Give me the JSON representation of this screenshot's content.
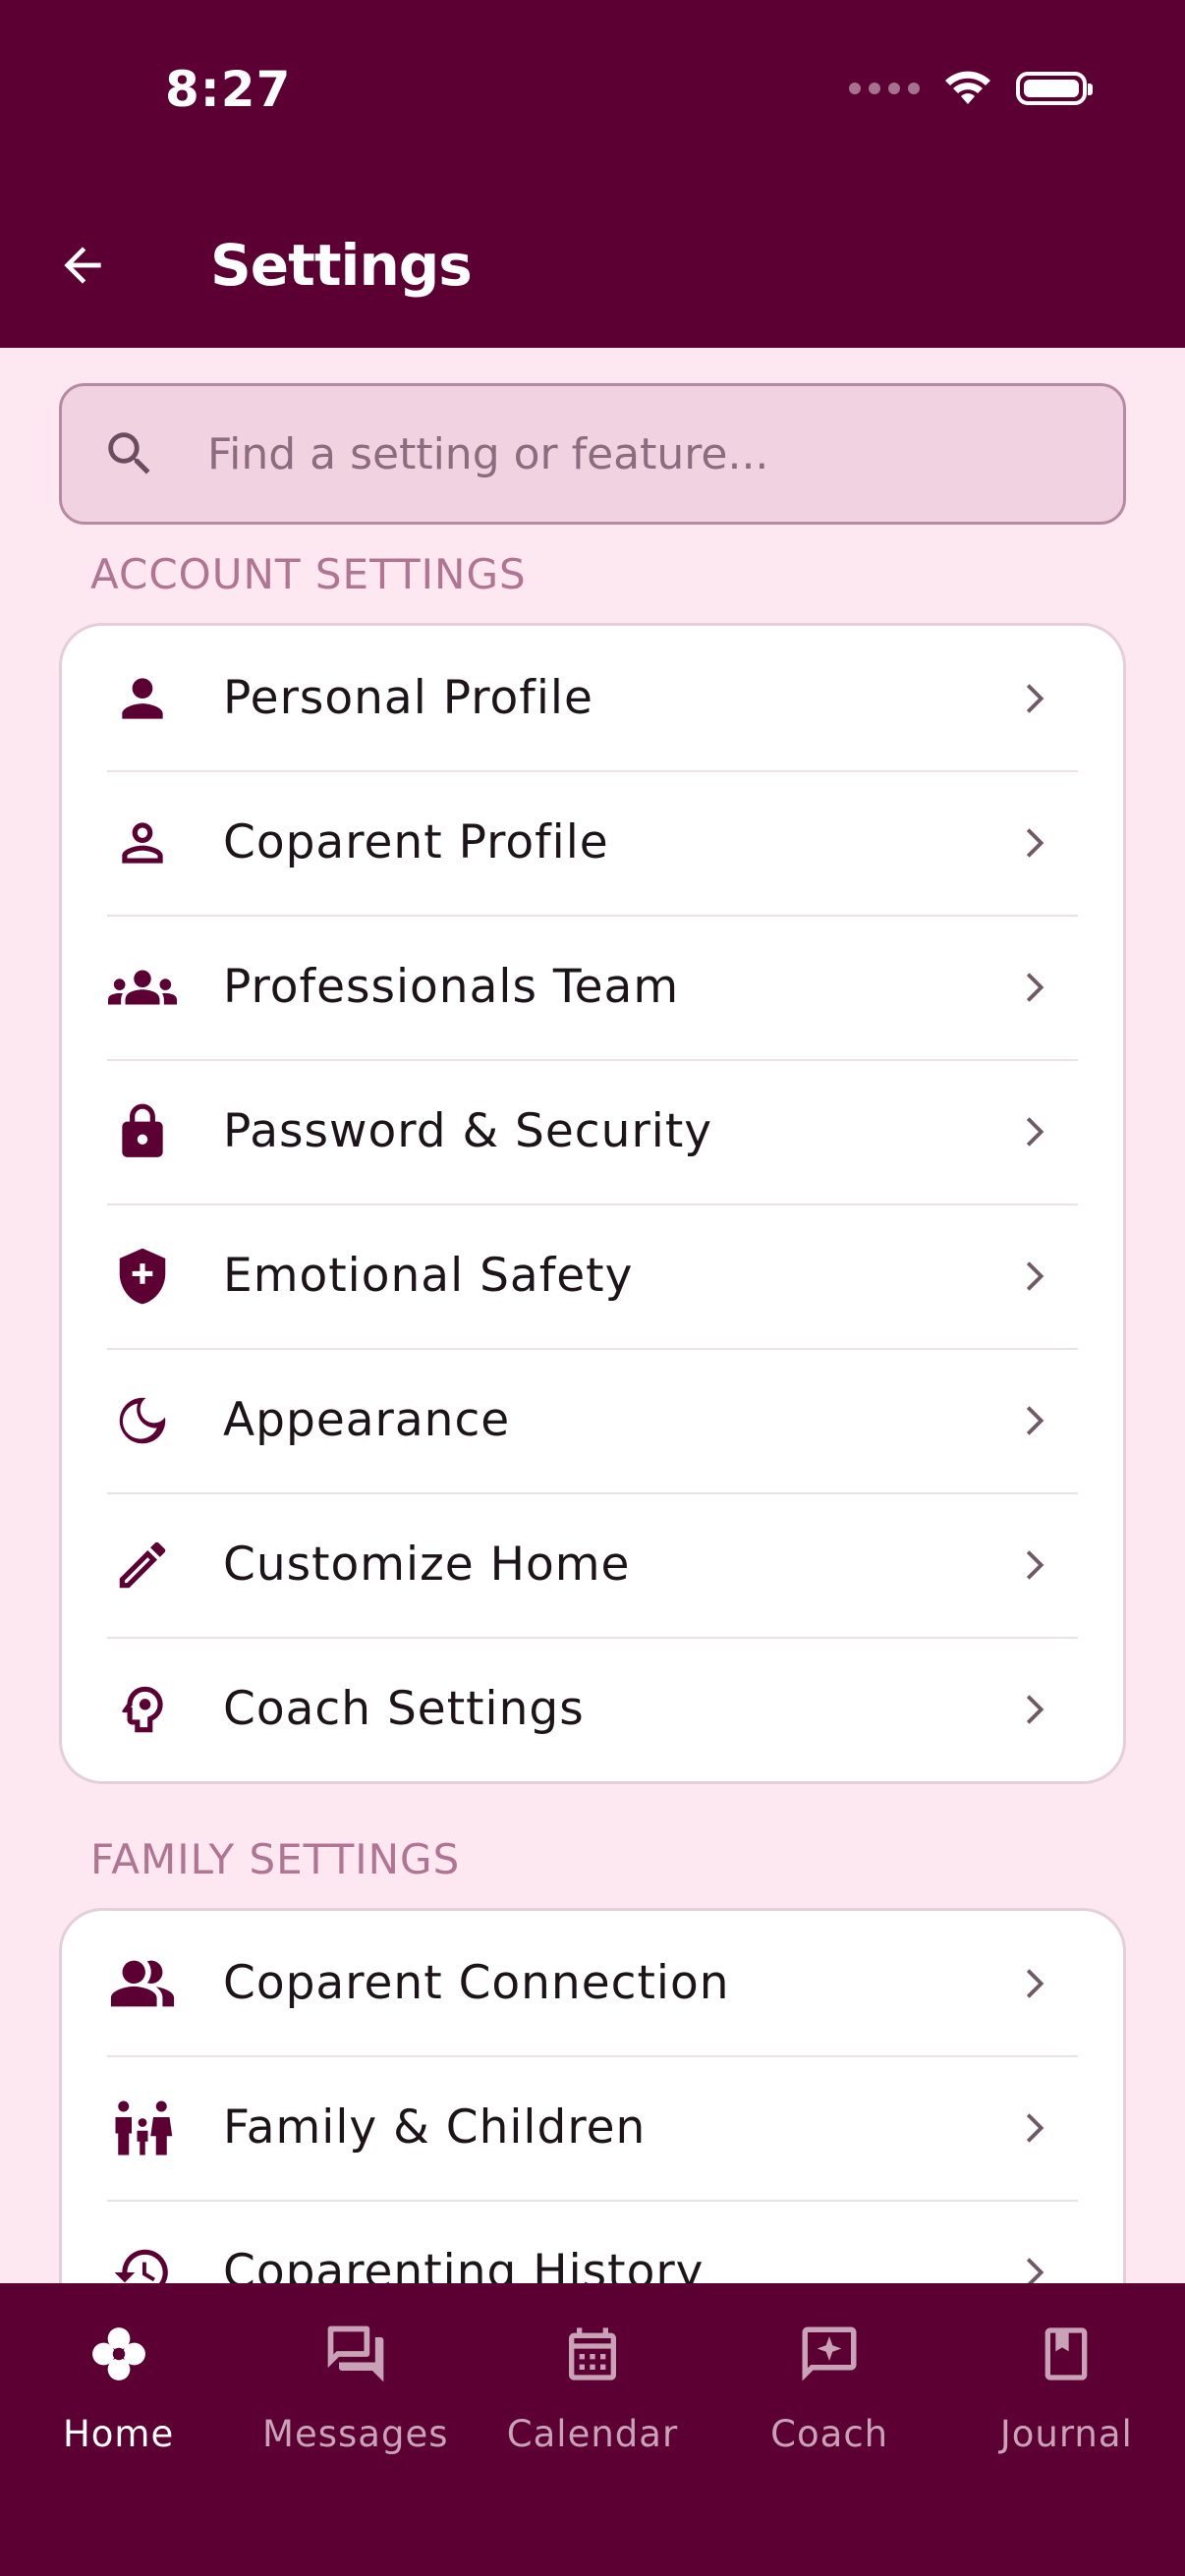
{
  "status": {
    "time": "8:27"
  },
  "header": {
    "title": "Settings"
  },
  "search": {
    "placeholder": "Find a setting or feature..."
  },
  "sections": {
    "account": {
      "title": "ACCOUNT SETTINGS",
      "items": [
        {
          "label": "Personal Profile",
          "icon": "person-icon"
        },
        {
          "label": "Coparent Profile",
          "icon": "person-outline-icon"
        },
        {
          "label": "Professionals Team",
          "icon": "groups-icon"
        },
        {
          "label": "Password & Security",
          "icon": "lock-icon"
        },
        {
          "label": "Emotional Safety",
          "icon": "shield-plus-icon"
        },
        {
          "label": "Appearance",
          "icon": "moon-icon"
        },
        {
          "label": "Customize Home",
          "icon": "pencil-icon"
        },
        {
          "label": "Coach Settings",
          "icon": "head-gear-icon"
        }
      ]
    },
    "family": {
      "title": "FAMILY SETTINGS",
      "items": [
        {
          "label": "Coparent Connection",
          "icon": "people-icon"
        },
        {
          "label": "Family & Children",
          "icon": "family-icon"
        },
        {
          "label": "Coparenting History",
          "icon": "history-icon"
        }
      ]
    }
  },
  "nav": {
    "items": [
      {
        "label": "Home",
        "icon": "flower-icon",
        "active": true
      },
      {
        "label": "Messages",
        "icon": "messages-icon",
        "active": false
      },
      {
        "label": "Calendar",
        "icon": "calendar-icon",
        "active": false
      },
      {
        "label": "Coach",
        "icon": "coach-sparkle-icon",
        "active": false
      },
      {
        "label": "Journal",
        "icon": "journal-icon",
        "active": false
      }
    ]
  },
  "colors": {
    "brand": "#5C0033",
    "background": "#FDE7F0",
    "accent_text": "#B07592"
  }
}
